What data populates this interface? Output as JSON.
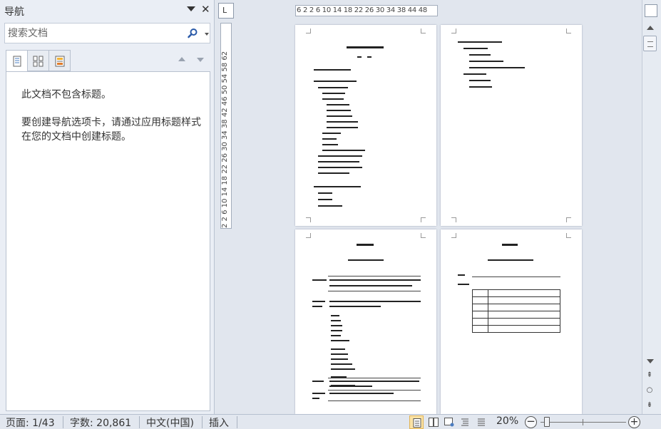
{
  "nav": {
    "title": "导航",
    "search_placeholder": "搜索文档",
    "empty_message": "此文档不包含标题。",
    "help_message": "要创建导航选项卡，请通过应用标题样式在您的文档中创建标题。"
  },
  "rulers": {
    "corner_label": "L",
    "horizontal_ticks": "6 2 2 6 10 14 18 22 26 30 34 38 44 48",
    "vertical_ticks": "2 2 6 10 14 18 22 26 30 34 38 42 46 50 54 58 62"
  },
  "status": {
    "page": "页面: 1/43",
    "words": "字数: 20,861",
    "language": "中文(中国)",
    "mode": "插入",
    "zoom": "20%",
    "zoom_level_percent": 20
  },
  "colors": {
    "nav_bg": "#eaeef5",
    "canvas_bg": "#e1e6ee",
    "active_view": "#fbe3a6"
  }
}
